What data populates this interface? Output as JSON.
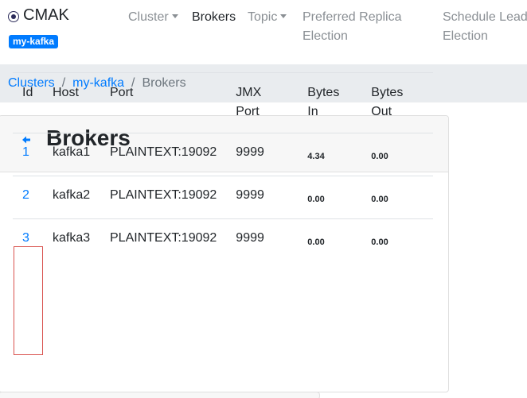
{
  "brand": {
    "name": "CMAK",
    "cluster_badge": "my-kafka"
  },
  "nav": {
    "cluster": "Cluster",
    "brokers": "Brokers",
    "topic": "Topic",
    "preferred_line1": "Preferred Replica",
    "preferred_line2": "Election",
    "schedule_line1": "Schedule Leade",
    "schedule_line2": "Election"
  },
  "breadcrumb": {
    "clusters": "Clusters",
    "cluster": "my-kafka",
    "current": "Brokers",
    "separator": "/"
  },
  "card": {
    "title": "Brokers"
  },
  "table": {
    "headers": {
      "id": "Id",
      "host": "Host",
      "port": "Port",
      "jmx_line1": "JMX",
      "jmx_line2": "Port",
      "bytes_in_line1": "Bytes",
      "bytes_in_line2": "In",
      "bytes_out_line1": "Bytes",
      "bytes_out_line2": "Out"
    },
    "rows": [
      {
        "id": "1",
        "host": "kafka1",
        "port": "PLAINTEXT:19092",
        "jmx": "9999",
        "bytes_in": "4.34",
        "bytes_out": "0.00"
      },
      {
        "id": "2",
        "host": "kafka2",
        "port": "PLAINTEXT:19092",
        "jmx": "9999",
        "bytes_in": "0.00",
        "bytes_out": "0.00"
      },
      {
        "id": "3",
        "host": "kafka3",
        "port": "PLAINTEXT:19092",
        "jmx": "9999",
        "bytes_in": "0.00",
        "bytes_out": "0.00"
      }
    ]
  },
  "colors": {
    "accent": "#007bff",
    "highlight": "#d9534f",
    "breadcrumb_bg": "#e9ecef"
  }
}
